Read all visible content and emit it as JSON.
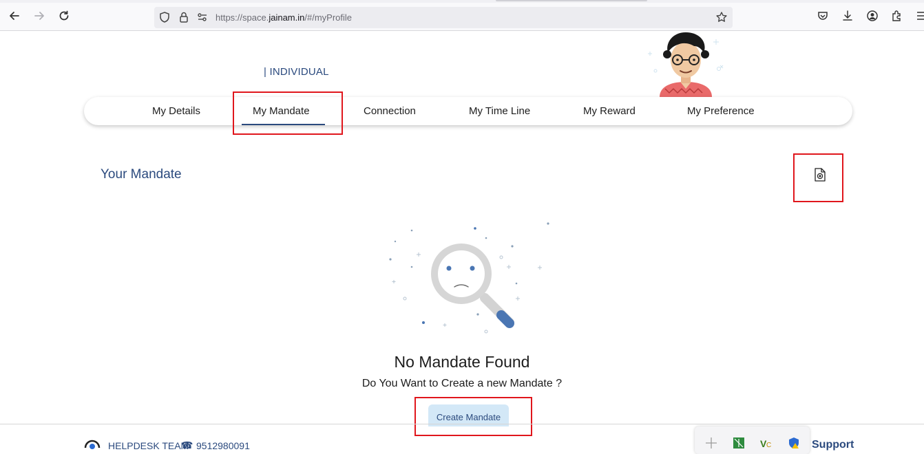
{
  "browser": {
    "url_prefix": "https://space.",
    "url_host": "jainam.in",
    "url_suffix": "/#/myProfile",
    "icons": [
      "back-icon",
      "forward-icon",
      "reload-icon",
      "shield-icon",
      "lock-icon",
      "permissions-icon",
      "bookmark-star-icon",
      "pocket-icon",
      "download-icon",
      "account-icon",
      "extensions-icon",
      "menu-icon"
    ]
  },
  "profile": {
    "account_type": "| INDIVIDUAL"
  },
  "tabs": [
    {
      "label": "My Details"
    },
    {
      "label": "My Mandate",
      "active": true
    },
    {
      "label": "Connection"
    },
    {
      "label": "My Time Line"
    },
    {
      "label": "My Reward"
    },
    {
      "label": "My Preference"
    }
  ],
  "mandate": {
    "section_title": "Your Mandate",
    "add_icon": "add-document-icon",
    "empty_title": "No Mandate Found",
    "empty_question": "Do You Want to Create a new Mandate ?",
    "create_button": "Create Mandate"
  },
  "footer": {
    "helpdesk_label": "HELPDESK TEAM",
    "phone": "9512980091",
    "support_label": "Support"
  },
  "colors": {
    "brand_blue": "#2b4a7e",
    "highlight_red": "#e0161c",
    "button_bg": "#d3e8f7"
  }
}
